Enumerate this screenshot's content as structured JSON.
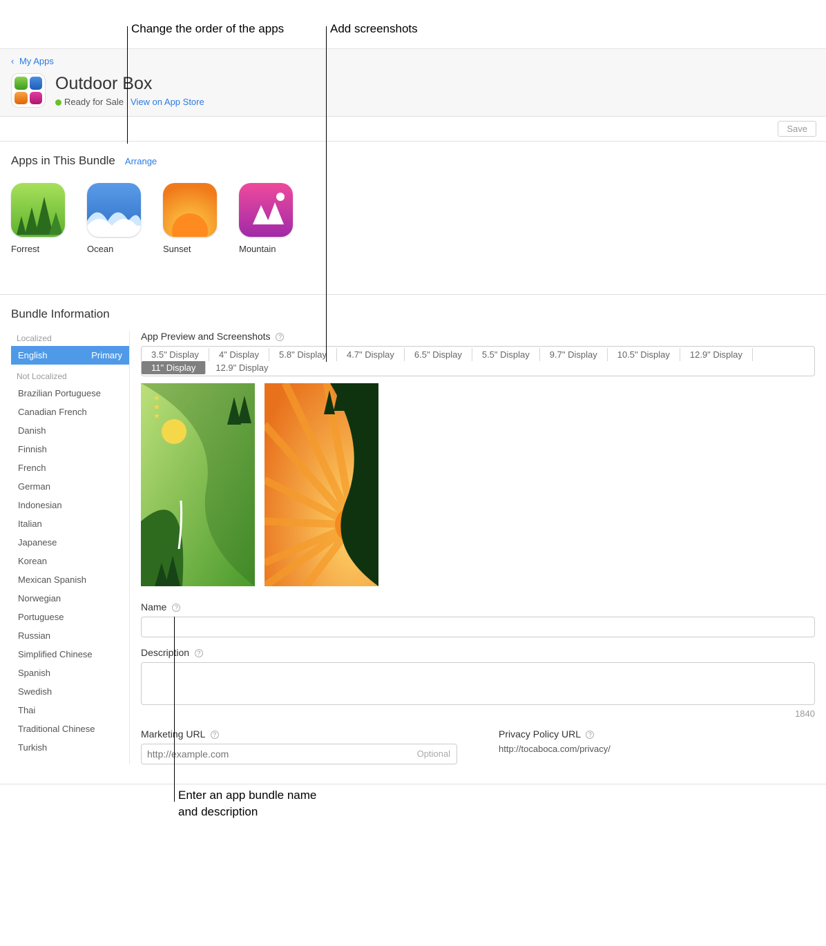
{
  "annotations": {
    "order": "Change the order of the apps",
    "add": "Add screenshots",
    "enter1": "Enter an app bundle name",
    "enter2": "and description"
  },
  "breadcrumb": {
    "back": "My Apps"
  },
  "header": {
    "title": "Outdoor Box",
    "status": "Ready for Sale",
    "view_link": "View on App Store"
  },
  "save_bar": {
    "save": "Save"
  },
  "apps_section": {
    "title": "Apps in This Bundle",
    "arrange": "Arrange",
    "apps": [
      {
        "name": "Forrest"
      },
      {
        "name": "Ocean"
      },
      {
        "name": "Sunset"
      },
      {
        "name": "Mountain"
      }
    ]
  },
  "bundle_info": {
    "title": "Bundle Information",
    "localized_head": "Localized",
    "not_localized_head": "Not Localized",
    "selected_lang": "English",
    "selected_badge": "Primary",
    "langs": [
      "Brazilian Portuguese",
      "Canadian French",
      "Danish",
      "Finnish",
      "French",
      "German",
      "Indonesian",
      "Italian",
      "Japanese",
      "Korean",
      "Mexican Spanish",
      "Norwegian",
      "Portuguese",
      "Russian",
      "Simplified Chinese",
      "Spanish",
      "Swedish",
      "Thai",
      "Traditional Chinese",
      "Turkish"
    ],
    "preview_label": "App Preview and Screenshots",
    "display_tabs": [
      "3.5\" Display",
      "4\" Display",
      "5.8\" Display",
      "4.7\" Display",
      "6.5\" Display",
      "5.5\" Display",
      "9.7\" Display",
      "10.5\" Display",
      "12.9\" Display",
      "11\" Display",
      "12.9\" Display"
    ],
    "name_label": "Name",
    "name_value": "",
    "desc_label": "Description",
    "desc_value": "",
    "char_count": "1840",
    "marketing_label": "Marketing URL",
    "marketing_placeholder": "http://example.com",
    "optional": "Optional",
    "privacy_label": "Privacy Policy URL",
    "privacy_value": "http://tocaboca.com/privacy/"
  }
}
